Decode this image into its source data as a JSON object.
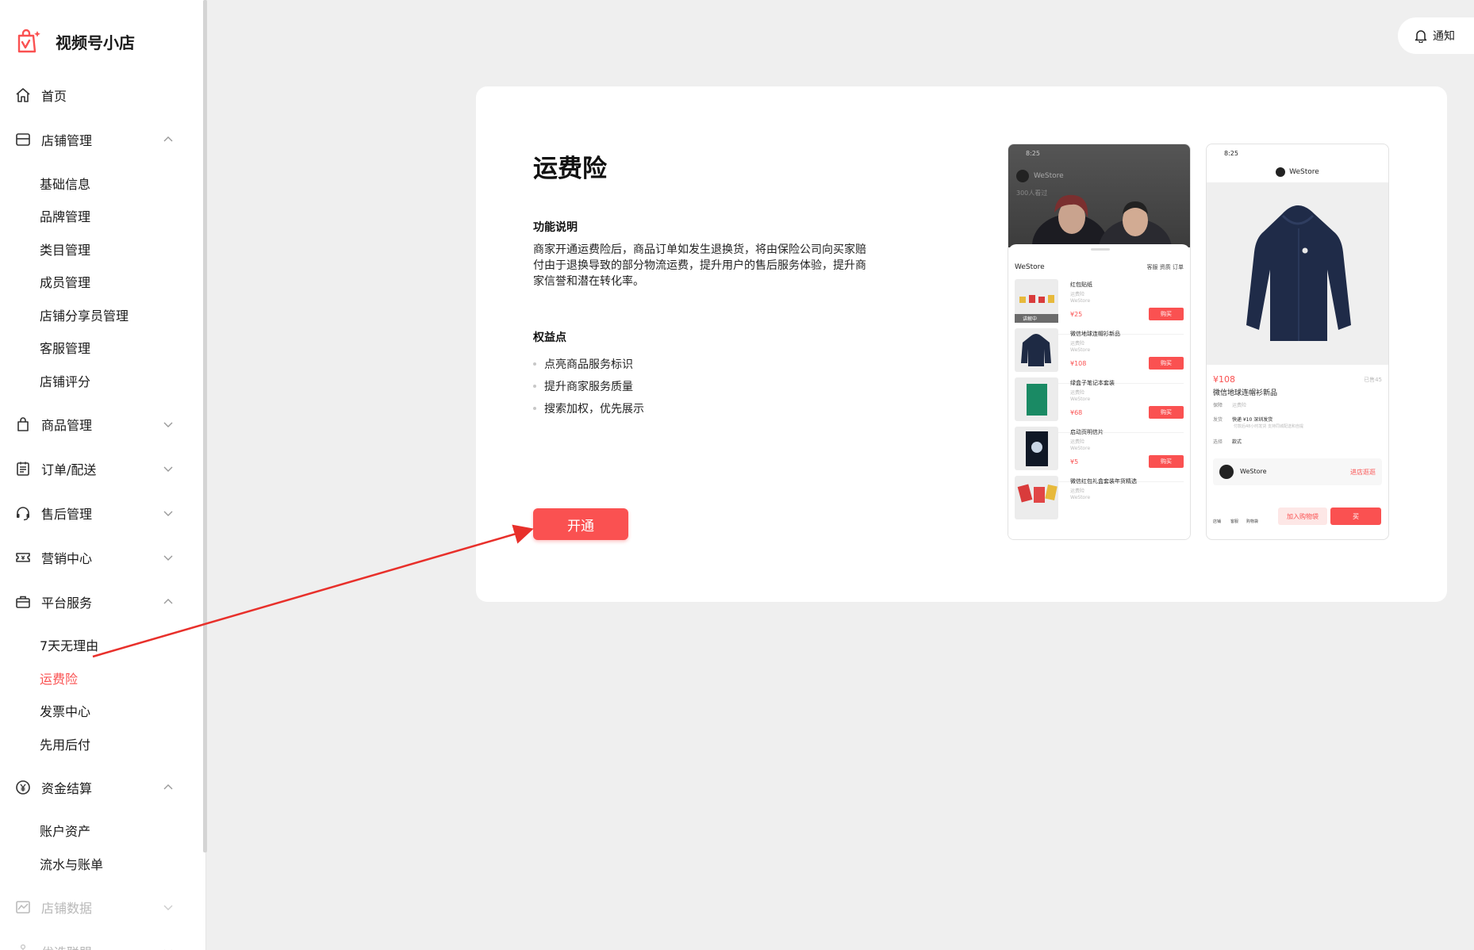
{
  "brand": {
    "name": "视频号小店"
  },
  "header": {
    "notice_label": "通知"
  },
  "sidebar": {
    "items": [
      {
        "label": "首页",
        "icon": "home-icon"
      },
      {
        "label": "店铺管理",
        "icon": "store-icon",
        "expanded": true,
        "children": [
          "基础信息",
          "品牌管理",
          "类目管理",
          "成员管理",
          "店铺分享员管理",
          "客服管理",
          "店铺评分"
        ]
      },
      {
        "label": "商品管理",
        "icon": "bag-icon",
        "expanded": false
      },
      {
        "label": "订单/配送",
        "icon": "order-icon",
        "expanded": false
      },
      {
        "label": "售后管理",
        "icon": "headset-icon",
        "expanded": false
      },
      {
        "label": "营销中心",
        "icon": "ticket-icon",
        "expanded": false
      },
      {
        "label": "平台服务",
        "icon": "briefcase-icon",
        "expanded": true,
        "children": [
          "7天无理由",
          "运费险",
          "发票中心",
          "先用后付"
        ],
        "active_child": "运费险"
      },
      {
        "label": "资金结算",
        "icon": "yen-icon",
        "expanded": true,
        "children": [
          "账户资产",
          "流水与账单"
        ]
      },
      {
        "label": "店铺数据",
        "icon": "chart-icon",
        "expanded": false
      },
      {
        "label": "优选联盟",
        "icon": "network-icon",
        "expanded": false
      }
    ]
  },
  "main": {
    "title": "运费险",
    "feature_title": "功能说明",
    "feature_desc": "商家开通运费险后，商品订单如发生退换货，将由保险公司向买家赔付由于退换导致的部分物流运费，提升用户的售后服务体验，提升商家信誉和潜在转化率。",
    "benefits_title": "权益点",
    "benefits": [
      "点亮商品服务标识",
      "提升商家服务质量",
      "搜索加权，优先展示"
    ],
    "open_button": "开通"
  },
  "mockup": {
    "time": "8:25",
    "store_name": "WeStore",
    "list_store": "WeStore",
    "viewers": "300人看过",
    "tabs": "客服 资质 订单",
    "live_badge": "讲解中",
    "products": [
      {
        "name": "红包贴纸",
        "tag": "运费险",
        "shop": "WeStore",
        "price": "¥25"
      },
      {
        "name": "微信地球连帽衫新品",
        "tag": "运费险",
        "shop": "WeStore",
        "price": "¥108"
      },
      {
        "name": "绿盒子笔记本套装",
        "tag": "运费险",
        "shop": "WeStore",
        "price": "¥68"
      },
      {
        "name": "启动页明信片",
        "tag": "运费险",
        "shop": "WeStore",
        "price": "¥5"
      },
      {
        "name": "微信红包礼盒套装年货精选",
        "tag": "运费险",
        "shop": "WeStore",
        "price": ""
      }
    ],
    "buy_label": "购买",
    "detail": {
      "price": "¥108",
      "sold": "已售45",
      "name": "微信地球连帽衫新品",
      "guarantee_label": "保障",
      "guarantee_value": "运费险",
      "ship_label": "发货",
      "ship_value": "快递 ¥10  深圳发货",
      "ship_note": "付款后48小时发货    支持同城配送和自提",
      "select_label": "选择",
      "select_value": "款式",
      "enter_store": "进店逛逛",
      "footer_icons": [
        "店铺",
        "客服",
        "购物袋"
      ],
      "add_cart": "加入购物袋",
      "buy": "买"
    }
  },
  "colors": {
    "accent": "#fa5151",
    "page_bg": "#efefef"
  }
}
